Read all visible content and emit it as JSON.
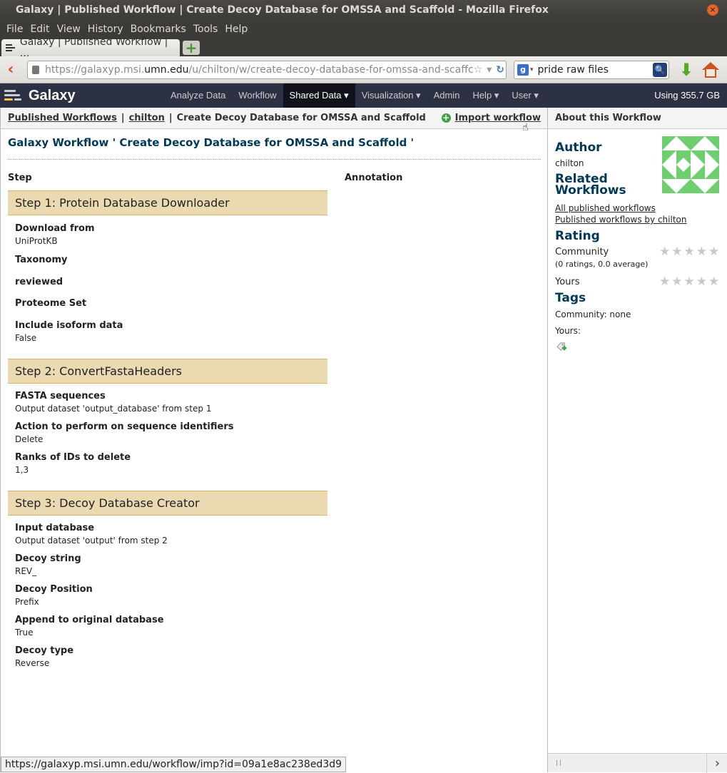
{
  "window": {
    "title": "Galaxy | Published Workflow | Create Decoy Database for OMSSA and Scaffold - Mozilla Firefox",
    "close_icon": "×"
  },
  "menubar": [
    "File",
    "Edit",
    "View",
    "History",
    "Bookmarks",
    "Tools",
    "Help"
  ],
  "tab": {
    "label": "Galaxy | Published Workflow | ..."
  },
  "newtab_label": "+",
  "urlbar": {
    "prefix": "https://galaxyp.msi.",
    "domain": "umn.edu",
    "suffix": "/u/chilton/w/create-decoy-database-for-omssa-and-scaffc",
    "star_icon": "☆",
    "dropdown_icon": "▾",
    "reload_icon": "↻"
  },
  "search": {
    "engine_icon": "g",
    "caret": "▾",
    "query": "pride raw files",
    "mag_icon": "🔍"
  },
  "toolbar": {
    "back_icon": "‹",
    "download_icon": "⬇"
  },
  "masthead": {
    "brand": "Galaxy",
    "nav": [
      "Analyze Data",
      "Workflow",
      "Shared Data ▾",
      "Visualization ▾",
      "Admin",
      "Help ▾",
      "User ▾"
    ],
    "active_index": 2,
    "usage": "Using 355.7 GB"
  },
  "breadcrumb": {
    "link1": "Published Workflows",
    "link2": "chilton",
    "current": "Create Decoy Database for OMSSA and Scaffold",
    "separator": "|",
    "import_icon": "+",
    "import_label": "Import workflow",
    "cursor": "☝"
  },
  "workflow": {
    "title": "Galaxy Workflow ' Create Decoy Database for OMSSA and Scaffold '",
    "col_step": "Step",
    "col_annotation": "Annotation",
    "steps": [
      {
        "title": "Step 1: Protein Database Downloader",
        "params": [
          {
            "label": "Download from",
            "value": "UniProtKB"
          },
          {
            "label": "Taxonomy",
            "value": ""
          },
          {
            "label": "reviewed",
            "value": ""
          },
          {
            "label": "Proteome Set",
            "value": ""
          },
          {
            "label": "Include isoform data",
            "value": "False"
          }
        ]
      },
      {
        "title": "Step 2: ConvertFastaHeaders",
        "params": [
          {
            "label": "FASTA sequences",
            "value": "Output dataset 'output_database' from step 1"
          },
          {
            "label": "Action to perform on sequence identifiers",
            "value": "Delete"
          },
          {
            "label": "Ranks of IDs to delete",
            "value": "1,3"
          }
        ]
      },
      {
        "title": "Step 3: Decoy Database Creator",
        "params": [
          {
            "label": "Input database",
            "value": "Output dataset 'output' from step 2"
          },
          {
            "label": "Decoy string",
            "value": "REV_"
          },
          {
            "label": "Decoy Position",
            "value": "Prefix"
          },
          {
            "label": "Append to original database",
            "value": "True"
          },
          {
            "label": "Decoy type",
            "value": "Reverse"
          }
        ]
      }
    ]
  },
  "status_url": "https://galaxyp.msi.umn.edu/workflow/imp?id=09a1e8ac238ed3d9",
  "sidebar": {
    "header": "About this Workflow",
    "author_heading": "Author",
    "author": "chilton",
    "related_heading": "Related Workflows",
    "link_all": "All published workflows",
    "link_by": "Published workflows by chilton",
    "rating_heading": "Rating",
    "community_label": "Community",
    "community_stats": "(0 ratings, 0.0 average)",
    "yours_label": "Yours",
    "star": "★",
    "tags_heading": "Tags",
    "tags_community": "Community: none",
    "tags_yours": "Yours:",
    "scroll_arrow": "›",
    "avatar_color": "#6ecf6e"
  }
}
